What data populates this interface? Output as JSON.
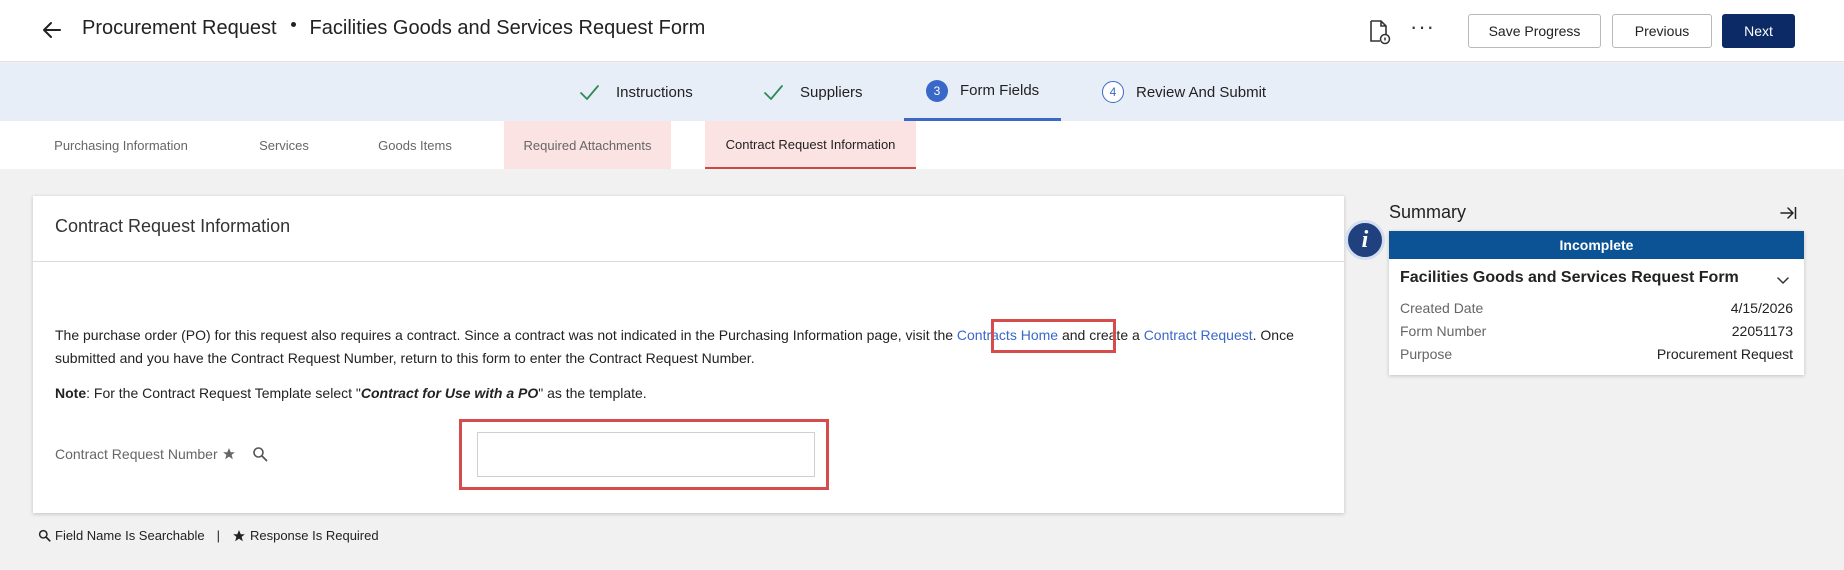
{
  "header": {
    "title_part1": "Procurement Request",
    "title_part2": "Facilities Goods and Services Request Form",
    "save_label": "Save Progress",
    "previous_label": "Previous",
    "next_label": "Next"
  },
  "stepper": {
    "steps": [
      {
        "number": "",
        "label": "Instructions",
        "state": "complete"
      },
      {
        "number": "",
        "label": "Suppliers",
        "state": "complete"
      },
      {
        "number": "3",
        "label": "Form Fields",
        "state": "active"
      },
      {
        "number": "4",
        "label": "Review And Submit",
        "state": "pending"
      }
    ]
  },
  "subtabs": [
    {
      "label": "Purchasing Information"
    },
    {
      "label": "Services"
    },
    {
      "label": "Goods Items"
    },
    {
      "label": "Required Attachments"
    },
    {
      "label": "Contract Request Information"
    }
  ],
  "main": {
    "title": "Contract Request Information",
    "para_before_link1": "The purchase order (PO) for this request also requires a contract.  Since a contract was not indicated in the Purchasing Information page, visit the ",
    "link1": "Contracts Home",
    "para_between": " and create a ",
    "link2": "Contract Request",
    "para_after": ". Once submitted and you have the Contract Request Number, return to this form to enter the Contract Request Number.",
    "note_label": "Note",
    "note_text1": ": For the Contract Request Template select \"",
    "note_emphasis": "Contract for Use with a PO",
    "note_text2": "\" as the template.",
    "field_label": "Contract Request Number",
    "field_value": ""
  },
  "legend": {
    "searchable": "Field Name Is Searchable",
    "separator": "|",
    "required": "Response Is Required"
  },
  "summary": {
    "title": "Summary",
    "status": "Incomplete",
    "form_name": "Facilities Goods and Services Request Form",
    "rows": [
      {
        "key": "Created Date",
        "value": "4/15/2026"
      },
      {
        "key": "Form Number",
        "value": "22051173"
      },
      {
        "key": "Purpose",
        "value": "Procurement Request"
      }
    ],
    "info_glyph": "i"
  },
  "colors": {
    "primary": "#0b2a66",
    "accent": "#3a68c9",
    "status_bar": "#0b5394",
    "highlight": "#d44c4c",
    "warn_tab": "#fbe3e3"
  },
  "icons": [
    "back-arrow-icon",
    "document-info-icon",
    "more-icon",
    "check-icon",
    "star-icon",
    "search-icon",
    "info-icon",
    "collapse-panel-icon",
    "chevron-down-icon"
  ]
}
